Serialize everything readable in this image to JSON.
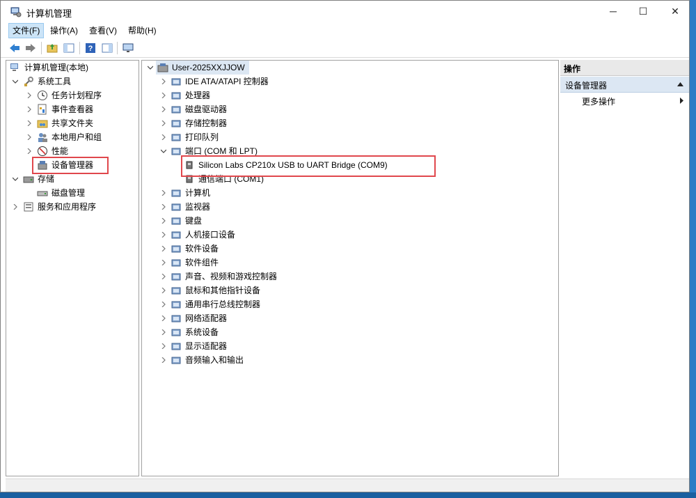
{
  "window": {
    "title": "计算机管理",
    "controls": {
      "minimize": "─",
      "maximize": "☐",
      "close": "✕"
    }
  },
  "menubar": {
    "items": [
      "文件(F)",
      "操作(A)",
      "查看(V)",
      "帮助(H)"
    ]
  },
  "left_tree": {
    "root": "计算机管理(本地)",
    "system_tools": "系统工具",
    "task_scheduler": "任务计划程序",
    "event_viewer": "事件查看器",
    "shared_folders": "共享文件夹",
    "local_users": "本地用户和组",
    "performance": "性能",
    "device_manager": "设备管理器",
    "storage": "存储",
    "disk_management": "磁盘管理",
    "services_apps": "服务和应用程序"
  },
  "device_tree": {
    "computer": "User-2025XXJJOW",
    "categories": [
      "IDE ATA/ATAPI 控制器",
      "处理器",
      "磁盘驱动器",
      "存储控制器",
      "打印队列",
      "端口 (COM 和 LPT)",
      "计算机",
      "监视器",
      "键盘",
      "人机接口设备",
      "软件设备",
      "软件组件",
      "声音、视频和游戏控制器",
      "鼠标和其他指针设备",
      "通用串行总线控制器",
      "网络适配器",
      "系统设备",
      "显示适配器",
      "音频输入和输出"
    ],
    "ports": [
      "Silicon Labs CP210x USB to UART Bridge (COM9)",
      "通信端口 (COM1)"
    ]
  },
  "actions": {
    "header": "操作",
    "section": "设备管理器",
    "more": "更多操作"
  },
  "colors": {
    "highlight": "#e0474c",
    "selection": "#dce7f3"
  }
}
